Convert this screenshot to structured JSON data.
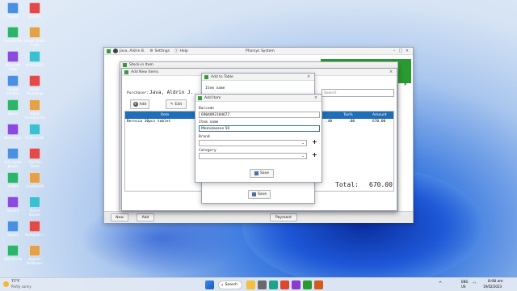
{
  "desktop_icons": [
    {
      "label": "This PC",
      "col": 0,
      "row": 0
    },
    {
      "label": "jardine I",
      "col": 1,
      "row": 0
    },
    {
      "label": "Recycle Bin",
      "col": 0,
      "row": 1
    },
    {
      "label": "Visual Studio Code",
      "col": 1,
      "row": 1
    },
    {
      "label": "Microsoft Edge",
      "col": 0,
      "row": 2
    },
    {
      "label": "Intellij IDEA",
      "col": 1,
      "row": 2
    },
    {
      "label": "Google Chrome",
      "col": 0,
      "row": 3
    },
    {
      "label": "Adobe Photoshop",
      "col": 1,
      "row": 3
    },
    {
      "label": "Steam",
      "col": 0,
      "row": 4
    },
    {
      "label": "Adobe Premiere Pro",
      "col": 1,
      "row": 4
    },
    {
      "label": "Messenger",
      "col": 0,
      "row": 5
    },
    {
      "label": "Eclipse IDE",
      "col": 1,
      "row": 5
    },
    {
      "label": "VLC media player",
      "col": 0,
      "row": 6
    },
    {
      "label": "FileZilla Client",
      "col": 1,
      "row": 6
    },
    {
      "label": "XAMPP",
      "col": 0,
      "row": 7
    },
    {
      "label": "CorelDRAW",
      "col": 1,
      "row": 7
    },
    {
      "label": "Discord",
      "col": 0,
      "row": 8
    },
    {
      "label": "Scene Builder",
      "col": 1,
      "row": 8
    },
    {
      "label": "Spotify",
      "col": 0,
      "row": 9
    },
    {
      "label": "Notepad++",
      "col": 1,
      "row": 9
    },
    {
      "label": "OBS Studio",
      "col": 0,
      "row": 10
    },
    {
      "label": "Apache NetBeans",
      "col": 1,
      "row": 10
    }
  ],
  "main_window": {
    "title": "Pharsys System",
    "user": "Java, Aldrin B.",
    "settings_label": "Settings",
    "help_label": "Help",
    "bottom_new": "New",
    "bottom_add": "Add",
    "bottom_payment": "Payment"
  },
  "stock_in_window": {
    "title": "Stock-in Item"
  },
  "add_new_items_window": {
    "title": "Add New Items",
    "purchaser_label": "Purchaser:",
    "purchaser_value": "Java, Aldrin J.",
    "add_button": "Add",
    "edit_button": "Edit",
    "columns": [
      "Item",
      "Tax%",
      "Amount"
    ],
    "row": {
      "item": "Berocca 10pcs tablet",
      "tax": ".00",
      "amount": "670.00",
      "vat": ".40"
    },
    "total_label": "Total:",
    "total_value": "670.00"
  },
  "add_to_table_window": {
    "title": "Add to Table",
    "item_name_label": "Item name",
    "search_placeholder": "Search",
    "save_button": "Save"
  },
  "add_item_dialog": {
    "title": "Add Item",
    "barcode_label": "Barcode",
    "barcode_value": "6904092104677",
    "item_name_label": "Item name",
    "item_name_value": "Memolassne 50",
    "brand_label": "Brand",
    "category_label": "Category",
    "save_button": "Save"
  },
  "taskbar": {
    "weather_temp": "77°F",
    "weather_desc": "Partly sunny",
    "search_label": "Search",
    "lang": "ENG",
    "region": "US",
    "time": "8:08 am",
    "date": "19/02/2023"
  },
  "colors": {
    "accent": "#2f6fb8",
    "table_header": "#1f6fb8",
    "status_green": "#2a9a30"
  }
}
